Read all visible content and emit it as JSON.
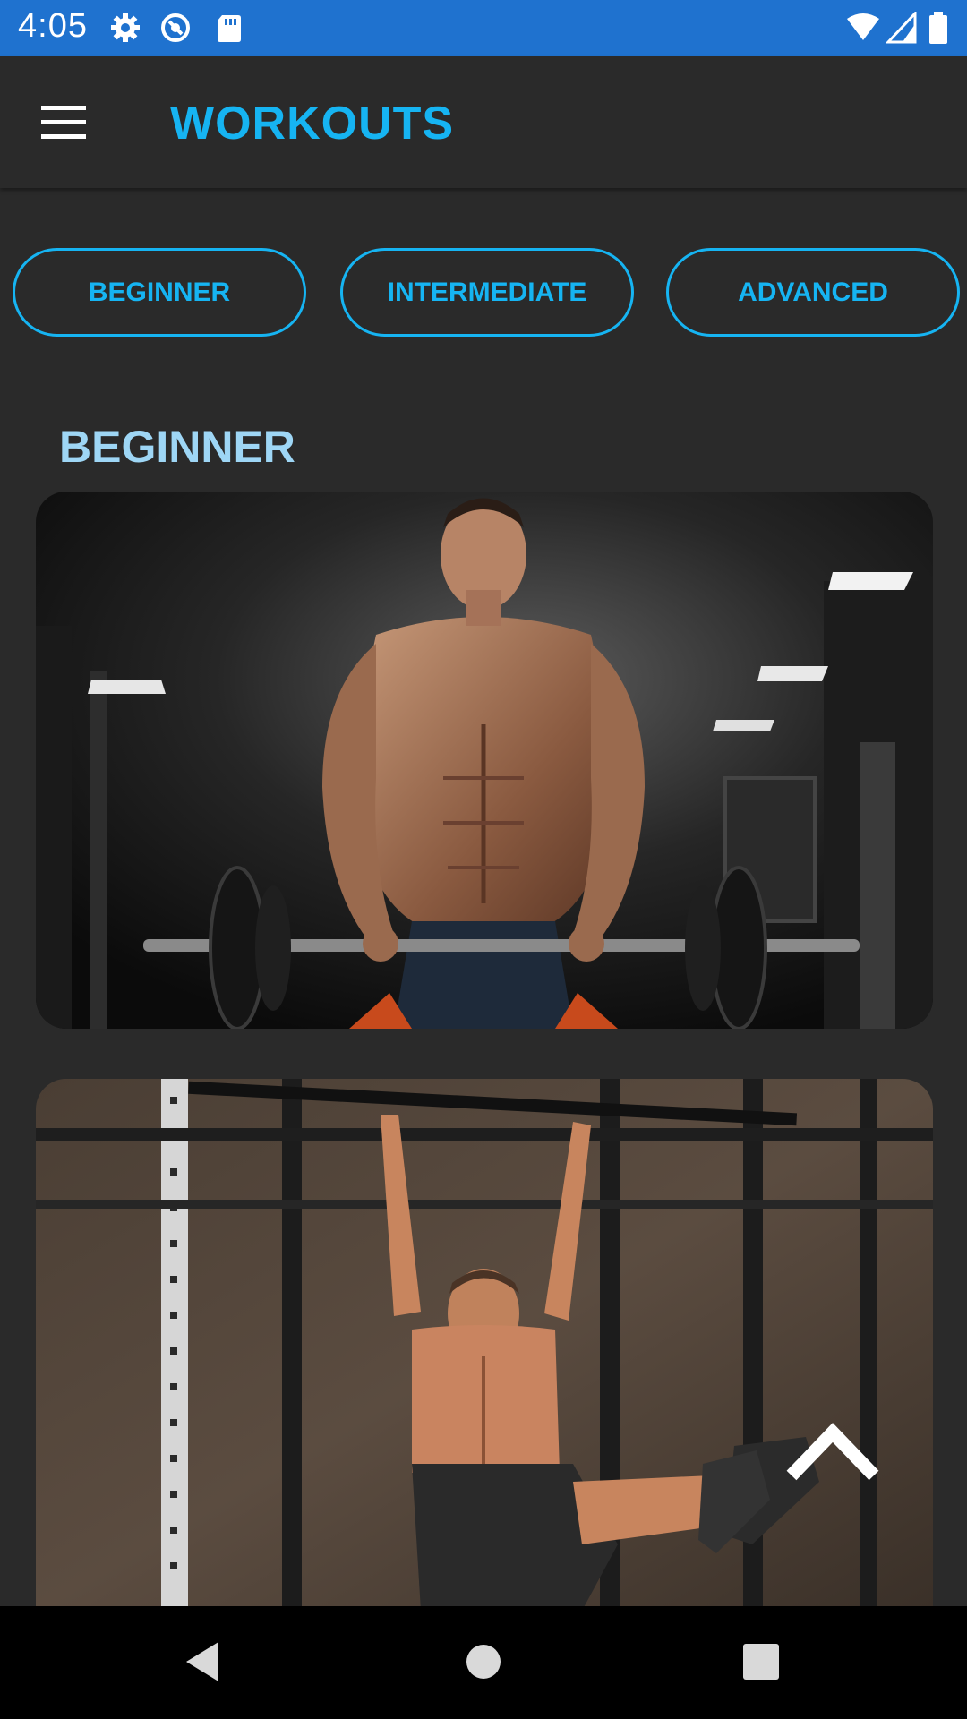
{
  "status_bar": {
    "time": "4:05",
    "icons": [
      "gear-icon",
      "sync-icon",
      "sd-card-icon",
      "wifi-icon",
      "cell-signal-icon",
      "battery-icon"
    ]
  },
  "app_bar": {
    "title": "WORKOUTS",
    "menu_icon": "hamburger-menu-icon"
  },
  "level_buttons": [
    {
      "label": "BEGINNER"
    },
    {
      "label": "INTERMEDIATE"
    },
    {
      "label": "ADVANCED"
    }
  ],
  "section": {
    "title": "BEGINNER"
  },
  "cards": [
    {
      "image": "man-barbell-curl-gym-photo"
    },
    {
      "image": "man-hanging-leg-raise-photo"
    }
  ],
  "scroll_top_icon": "chevron-up-icon",
  "nav_bar": {
    "icons": [
      "back-icon",
      "home-icon",
      "recents-icon"
    ]
  },
  "colors": {
    "status_bar": "#1f72cf",
    "background": "#2a2a2a",
    "accent": "#16b4f2",
    "section_title": "#9ed6f5"
  }
}
